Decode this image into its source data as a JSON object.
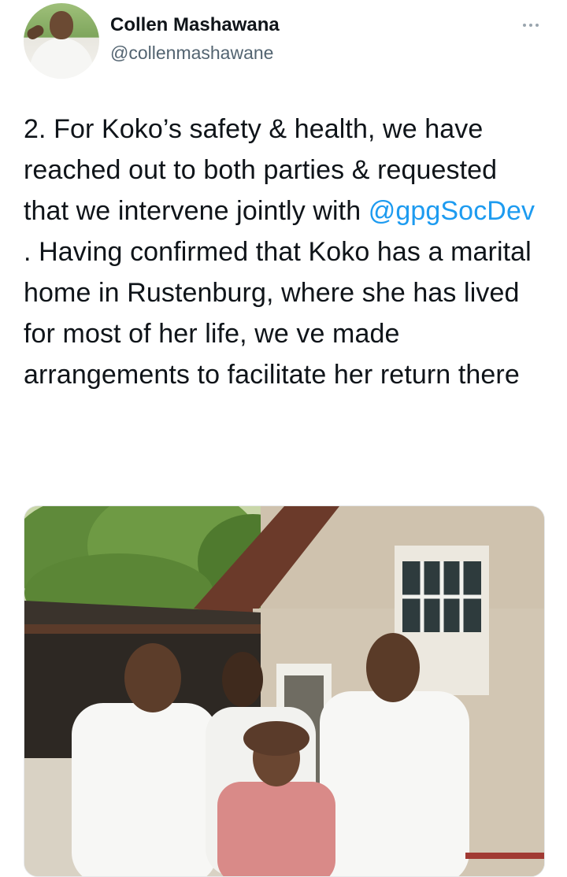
{
  "author": {
    "display_name": "Collen Mashawana",
    "handle": "@collenmashawane"
  },
  "tweet": {
    "text_before": "2. For Koko’s safety & health, we have reached out to both parties & requested that we intervene jointly with ",
    "mention": "@gpgSocDev",
    "text_after": " . Having confirmed that Koko has a marital home in Rustenburg, where she has lived for most of her life, we ve made arrangements to facilitate her return there"
  },
  "icons": {
    "more": "more-horizontal-icon"
  },
  "colors": {
    "mention": "#1d9bf0",
    "text": "#0f1419",
    "secondary": "#536471"
  }
}
